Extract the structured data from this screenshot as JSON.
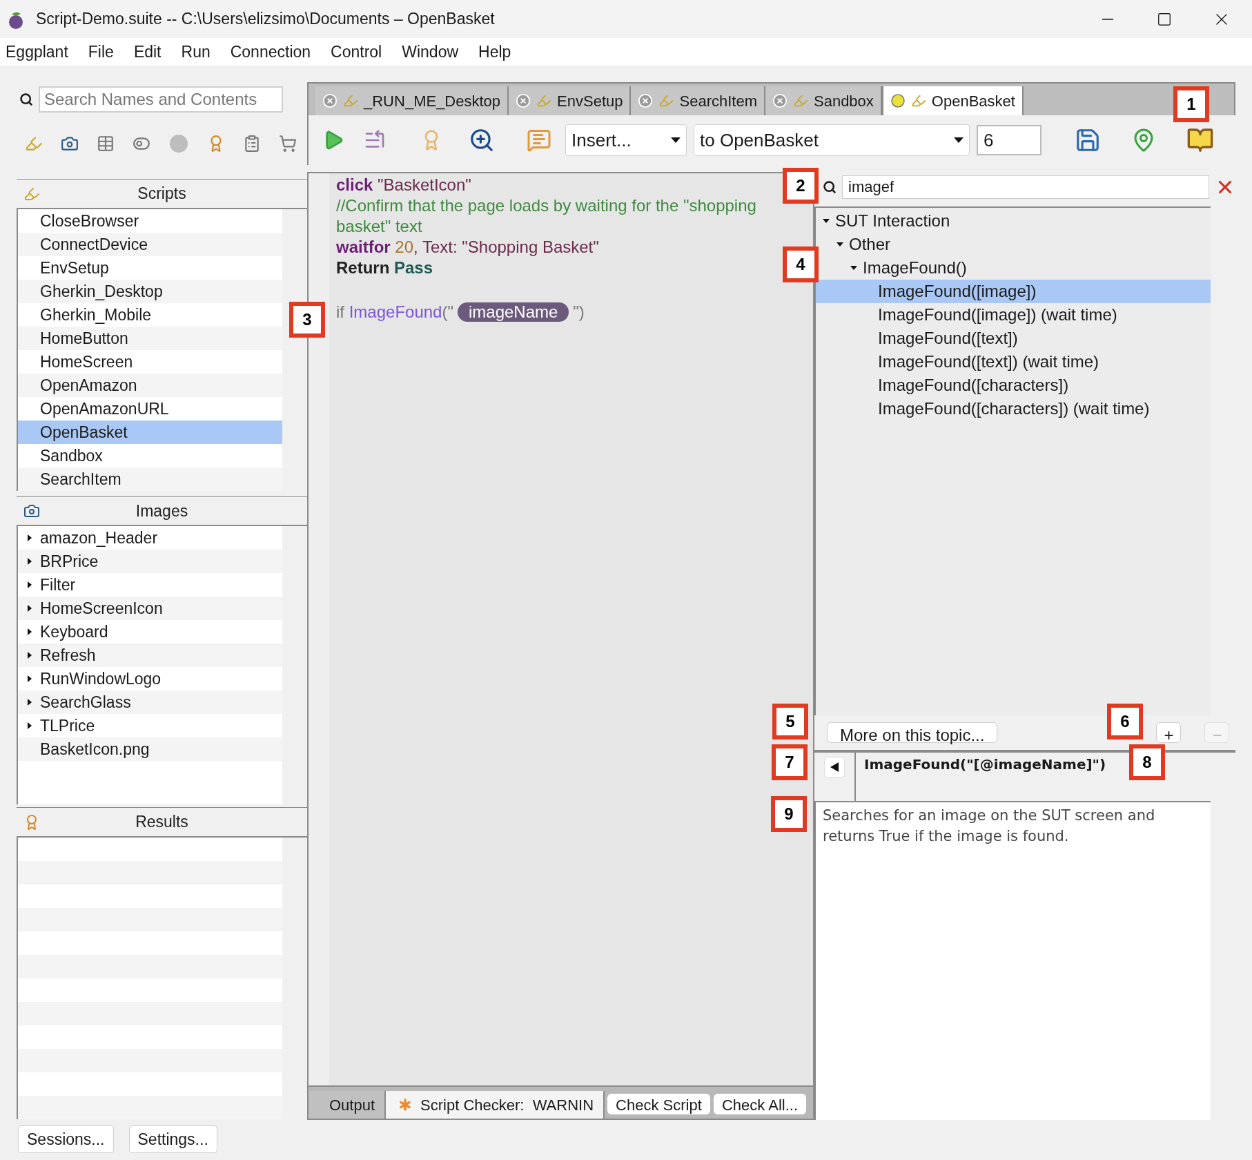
{
  "window": {
    "title": "Script-Demo.suite -- C:\\Users\\elizsimo\\Documents – OpenBasket"
  },
  "menu": [
    "Eggplant",
    "File",
    "Edit",
    "Run",
    "Connection",
    "Control",
    "Window",
    "Help"
  ],
  "sidebar": {
    "search": {
      "placeholder": "Search Names and Contents"
    },
    "scripts": {
      "title": "Scripts",
      "items": [
        {
          "label": "CloseBrowser",
          "selected": false
        },
        {
          "label": "ConnectDevice",
          "selected": false
        },
        {
          "label": "EnvSetup",
          "selected": false
        },
        {
          "label": "Gherkin_Desktop",
          "selected": false
        },
        {
          "label": "Gherkin_Mobile",
          "selected": false
        },
        {
          "label": "HomeButton",
          "selected": false
        },
        {
          "label": "HomeScreen",
          "selected": false
        },
        {
          "label": "OpenAmazon",
          "selected": false
        },
        {
          "label": "OpenAmazonURL",
          "selected": false
        },
        {
          "label": "OpenBasket",
          "selected": true
        },
        {
          "label": "Sandbox",
          "selected": false
        },
        {
          "label": "SearchItem",
          "selected": false
        }
      ]
    },
    "images": {
      "title": "Images",
      "items": [
        {
          "label": "amazon_Header",
          "kind": "folder",
          "expanded": false
        },
        {
          "label": "BRPrice",
          "kind": "folder",
          "expanded": false
        },
        {
          "label": "Filter",
          "kind": "folder",
          "expanded": false
        },
        {
          "label": "HomeScreenIcon",
          "kind": "folder",
          "expanded": false
        },
        {
          "label": "Keyboard",
          "kind": "folder",
          "expanded": false
        },
        {
          "label": "Refresh",
          "kind": "folder",
          "expanded": false
        },
        {
          "label": "RunWindowLogo",
          "kind": "folder",
          "expanded": false
        },
        {
          "label": "SearchGlass",
          "kind": "folder",
          "expanded": false
        },
        {
          "label": "TLPrice",
          "kind": "folder",
          "expanded": false
        },
        {
          "label": "BasketIcon.png",
          "kind": "file"
        }
      ]
    },
    "results": {
      "title": "Results"
    },
    "buttons": [
      "Sessions...",
      "Settings..."
    ]
  },
  "tabs": [
    {
      "label": "_RUN_ME_Desktop",
      "selected": false
    },
    {
      "label": "EnvSetup",
      "selected": false
    },
    {
      "label": "SearchItem",
      "selected": false
    },
    {
      "label": "Sandbox",
      "selected": false
    },
    {
      "label": "OpenBasket",
      "selected": true
    }
  ],
  "toolbar": {
    "insert": "Insert...",
    "handler": "to OpenBasket",
    "count": "6"
  },
  "editor": {
    "lines": [
      [
        {
          "kind": "keyword",
          "text": "click"
        },
        {
          "kind": "string",
          "text": " \"BasketIcon\""
        }
      ],
      [
        {
          "kind": "comment",
          "text": "//Confirm that the page loads by waiting for the \"shopping basket\" text"
        }
      ],
      [
        {
          "kind": "keyword",
          "text": "waitfor"
        },
        {
          "kind": "number",
          "text": " 20"
        },
        {
          "kind": "string",
          "text": ", Text: \"Shopping Basket\""
        }
      ],
      [
        {
          "kind": "bold",
          "text": "Return"
        },
        {
          "kind": "constant",
          "text": " Pass"
        }
      ],
      [
        {
          "kind": "plain",
          "text": "if "
        },
        {
          "kind": "function",
          "text": "ImageFound"
        },
        {
          "kind": "plain",
          "text": "(\""
        },
        {
          "kind": "placeholder",
          "text": "imageName"
        },
        {
          "kind": "plain",
          "text": "\")"
        }
      ]
    ]
  },
  "help": {
    "search": {
      "value": "imagef"
    },
    "tree": [
      {
        "label": "SUT Interaction",
        "expanded": true,
        "selected": false,
        "children": [
          {
            "label": "Other",
            "expanded": true,
            "selected": false,
            "children": [
              {
                "label": "ImageFound()",
                "expanded": true,
                "selected": false,
                "children": [
                  {
                    "label": "ImageFound([image])",
                    "selected": true
                  },
                  {
                    "label": "ImageFound([image]) (wait time)",
                    "selected": false
                  },
                  {
                    "label": "ImageFound([text])",
                    "selected": false
                  },
                  {
                    "label": "ImageFound([text]) (wait time)",
                    "selected": false
                  },
                  {
                    "label": "ImageFound([characters])",
                    "selected": false
                  },
                  {
                    "label": "ImageFound([characters]) (wait time)",
                    "selected": false
                  }
                ]
              }
            ]
          }
        ]
      }
    ],
    "more_button": "More on this topic...",
    "add_button": {
      "label": "+",
      "disabled": false
    },
    "remove_button": {
      "label": "−",
      "disabled": true
    },
    "signature": "ImageFound(\"[@imageName]\")",
    "description": "Searches for an image on the SUT screen and returns True if the image is found."
  },
  "bottom_tabs": [
    {
      "label": "Output",
      "kind": "plain",
      "selected": false
    },
    {
      "label": "Script Checker:  WARNIN",
      "kind": "checker",
      "selected": true
    }
  ],
  "checker_buttons": [
    "Check Script",
    "Check All..."
  ],
  "callouts": [
    {
      "label": "1"
    },
    {
      "label": "2"
    },
    {
      "label": "3"
    },
    {
      "label": "4"
    },
    {
      "label": "5"
    },
    {
      "label": "6"
    },
    {
      "label": "7"
    },
    {
      "label": "8"
    },
    {
      "label": "9"
    }
  ]
}
